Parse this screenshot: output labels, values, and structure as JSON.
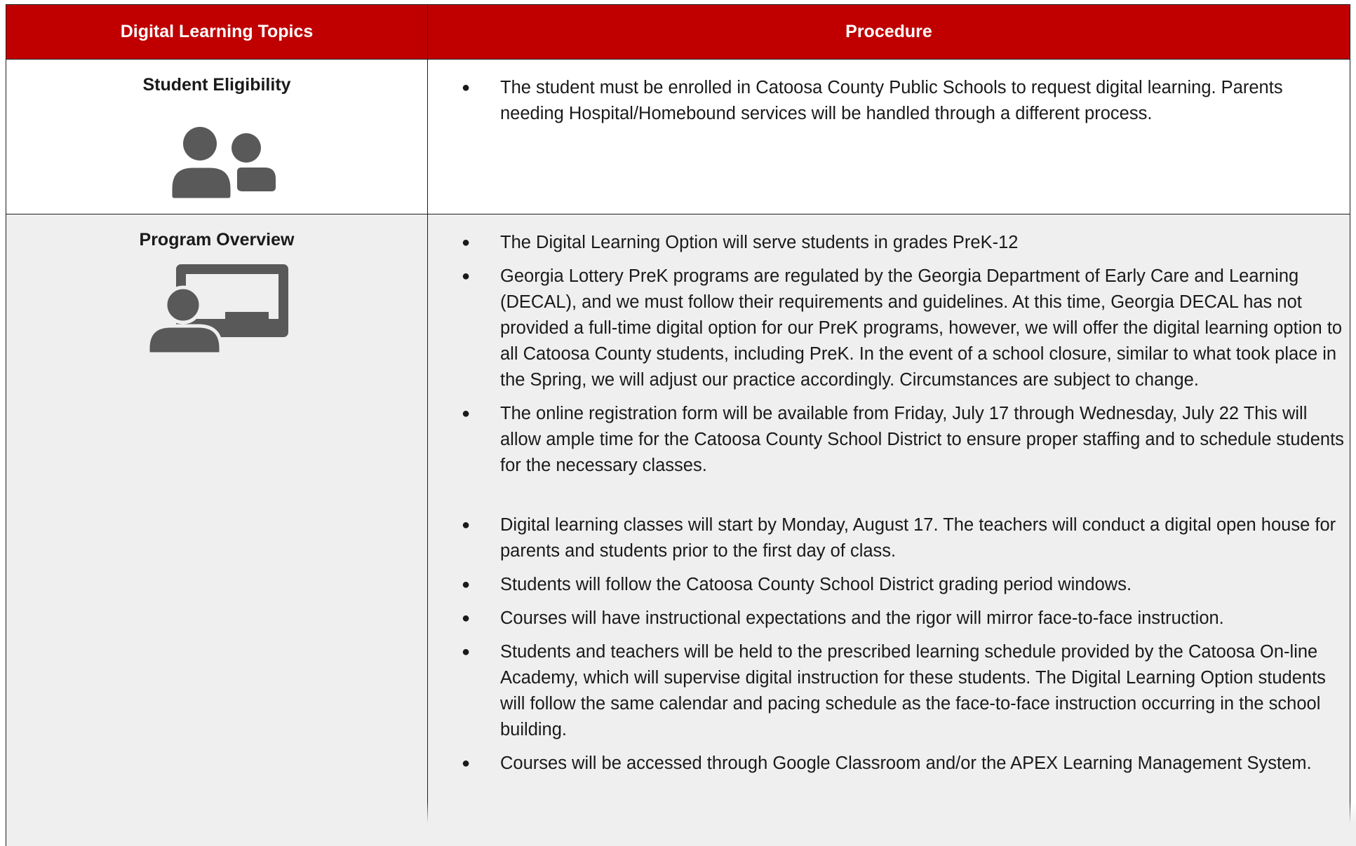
{
  "header": {
    "topics_label": "Digital Learning Topics",
    "procedure_label": "Procedure"
  },
  "rows": [
    {
      "topic": "Student Eligibility",
      "icon": "users-icon",
      "items": [
        "The student must be enrolled in Catoosa County Public Schools to request digital learning. Parents needing Hospital/Homebound services will be handled through a different process."
      ]
    },
    {
      "topic": "Program Overview",
      "icon": "teacher-presentation-icon",
      "items": [
        "The Digital Learning Option will serve students in grades PreK-12",
        "Georgia Lottery PreK programs are regulated by the Georgia Department of Early Care and Learning (DECAL), and we must follow their requirements and guidelines. At this time, Georgia DECAL has not provided a full-time digital option for our PreK programs, however, we will offer the digital learning option to all Catoosa County students, including PreK. In the event of a school closure, similar to what took place in the Spring, we will adjust our practice accordingly. Circumstances are subject to change.",
        "The online registration form will be available from Friday, July 17 through Wednesday, July 22 This will allow ample time for the Catoosa County School District to ensure proper staffing and to schedule students for the necessary classes.",
        "Digital learning classes will start by Monday, August 17. The teachers will conduct a digital open house for parents and students prior to the first day of class.",
        "Students will follow the Catoosa County School District grading period windows.",
        "Courses will have instructional expectations and the rigor will mirror face-to-face instruction.",
        "Students and teachers will be held to the prescribed learning schedule provided by the Catoosa On-line Academy, which will supervise digital instruction for these students. The Digital Learning Option students will follow the same calendar and pacing schedule as the face-to-face instruction occurring in the school building.",
        "Courses will be accessed through Google Classroom and/or the APEX Learning Management System."
      ]
    }
  ],
  "colors": {
    "header_bg": "#c00000",
    "header_text": "#ffffff",
    "row_alt_bg": "#efefef",
    "icon_color": "#595959"
  }
}
